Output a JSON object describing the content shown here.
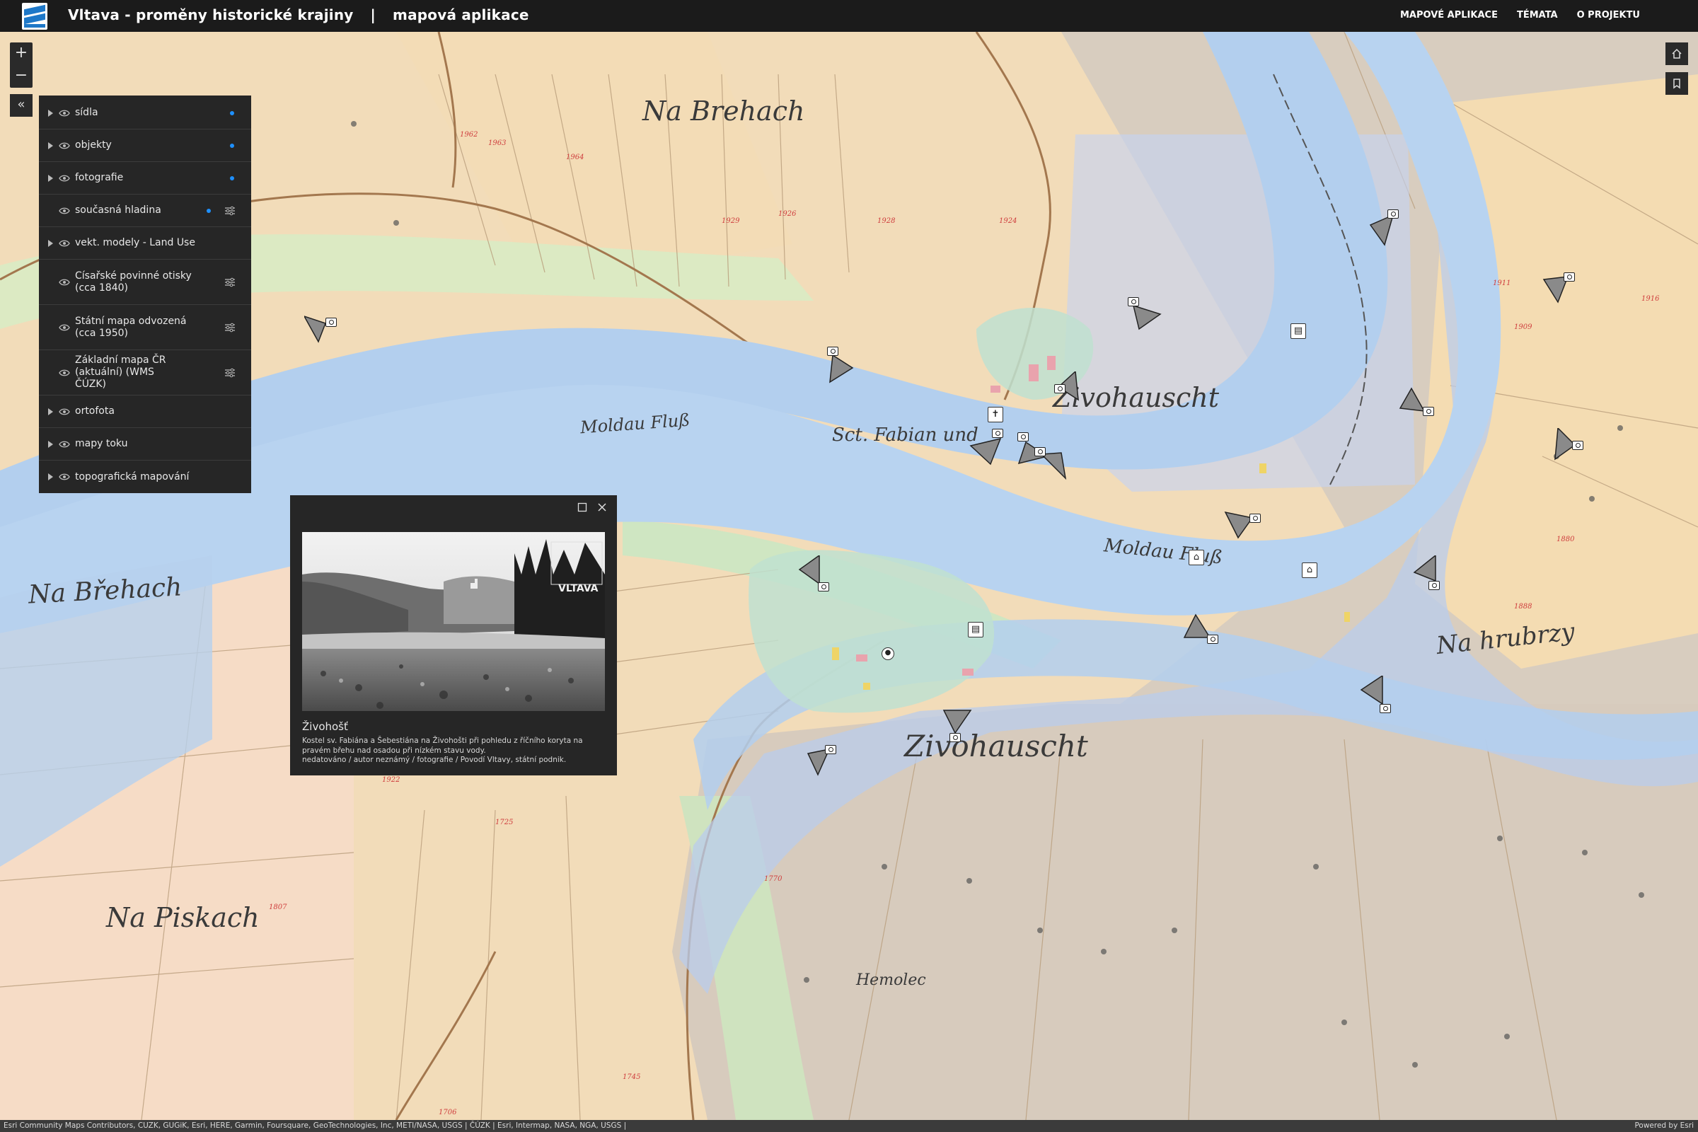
{
  "header": {
    "title": "Vltava - proměny historické krajiny",
    "separator": "|",
    "subtitle": "mapová aplikace",
    "nav": [
      "MAPOVÉ APLIKACE",
      "TÉMATA",
      "O PROJEKTU"
    ]
  },
  "controls": {
    "zoom_in": "+",
    "zoom_out": "−",
    "collapse": "«"
  },
  "layers": [
    {
      "label": "sídla",
      "expandable": true,
      "dot": true,
      "options": false
    },
    {
      "label": "objekty",
      "expandable": true,
      "dot": true,
      "options": false
    },
    {
      "label": "fotografie",
      "expandable": true,
      "dot": true,
      "options": false
    },
    {
      "label": "současná hladina",
      "expandable": false,
      "dot": true,
      "options": true
    },
    {
      "label": "vekt. modely - Land Use",
      "expandable": true,
      "dot": false,
      "options": false
    },
    {
      "label": "Císařské povinné otisky (cca 1840)",
      "expandable": false,
      "dot": false,
      "options": true
    },
    {
      "label": "Státní mapa odvozená (cca 1950)",
      "expandable": false,
      "dot": false,
      "options": true
    },
    {
      "label": "Základní mapa ČR (aktuální) (WMS ČÚZK)",
      "expandable": false,
      "dot": false,
      "options": true
    },
    {
      "label": "ortofota",
      "expandable": true,
      "dot": false,
      "options": false
    },
    {
      "label": "mapy toku",
      "expandable": true,
      "dot": false,
      "options": false
    },
    {
      "label": "topografická mapování",
      "expandable": true,
      "dot": false,
      "options": false
    }
  ],
  "popup": {
    "title": "Živohošť",
    "description": "Kostel sv. Fabiána a Šebestiána na Živohošti při pohledu z říčního koryta na pravém břehu nad osadou při nízkém stavu vody.",
    "credit": "nedatováno / autor neznámý / fotografie / Povodí Vltavy, státní podnik.",
    "photo_watermark": "VLTAVA"
  },
  "map_labels": {
    "na_brehach_top": "Na Brehach",
    "na_brehach_left": "Na Břehach",
    "na_piskach": "Na Piskach",
    "zivohauscht_top": "Zivohauscht",
    "zivohauscht_bottom": "Zivohauscht",
    "sct_fabian": "Sct. Fabian und",
    "moldau_fluss_1": "Moldau Fluß",
    "moldau_fluss_2": "Moldau Fluß",
    "na_hrubrzy": "Na hrubrzy",
    "hemolec": "Hemolec"
  },
  "attribution": {
    "text": "Esri Community Maps Contributors, CUZK, GUGiK, Esri, HERE, Garmin, Foursquare, GeoTechnologies, Inc, METI/NASA, USGS | ČÚZK | Esri, Intermap, NASA, NGA, USGS |",
    "powered": "Powered by Esri"
  }
}
